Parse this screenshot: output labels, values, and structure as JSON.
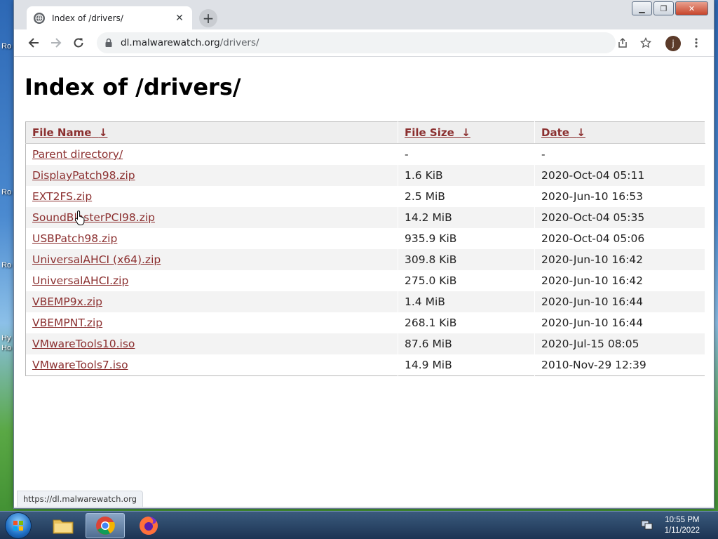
{
  "desktop": {
    "labels": [
      "Ro",
      "Ro",
      "Ro",
      "Hy",
      "Ho"
    ]
  },
  "browser": {
    "tab": {
      "title": "Index of /drivers/"
    },
    "omnibox": {
      "host": "dl.malwarewatch.org",
      "path": "/drivers/"
    },
    "avatar_letter": "j",
    "status_url": "https://dl.malwarewatch.org"
  },
  "page": {
    "title": "Index of /drivers/",
    "columns": {
      "name": "File Name",
      "size": "File Size",
      "date": "Date",
      "sort_arrow": "↓"
    },
    "rows": [
      {
        "name": "Parent directory/",
        "size": "-",
        "date": "-"
      },
      {
        "name": "DisplayPatch98.zip",
        "size": "1.6 KiB",
        "date": "2020-Oct-04 05:11"
      },
      {
        "name": "EXT2FS.zip",
        "size": "2.5 MiB",
        "date": "2020-Jun-10 16:53"
      },
      {
        "name": "SoundBlasterPCI98.zip",
        "size": "14.2 MiB",
        "date": "2020-Oct-04 05:35"
      },
      {
        "name": "USBPatch98.zip",
        "size": "935.9 KiB",
        "date": "2020-Oct-04 05:06"
      },
      {
        "name": "UniversalAHCI (x64).zip",
        "size": "309.8 KiB",
        "date": "2020-Jun-10 16:42"
      },
      {
        "name": "UniversalAHCI.zip",
        "size": "275.0 KiB",
        "date": "2020-Jun-10 16:42"
      },
      {
        "name": "VBEMP9x.zip",
        "size": "1.4 MiB",
        "date": "2020-Jun-10 16:44"
      },
      {
        "name": "VBEMPNT.zip",
        "size": "268.1 KiB",
        "date": "2020-Jun-10 16:44"
      },
      {
        "name": "VMwareTools10.iso",
        "size": "87.6 MiB",
        "date": "2020-Jul-15 08:05"
      },
      {
        "name": "VMwareTools7.iso",
        "size": "14.9 MiB",
        "date": "2010-Nov-29 12:39"
      }
    ]
  },
  "taskbar": {
    "time": "10:55 PM",
    "date": "1/11/2022"
  }
}
